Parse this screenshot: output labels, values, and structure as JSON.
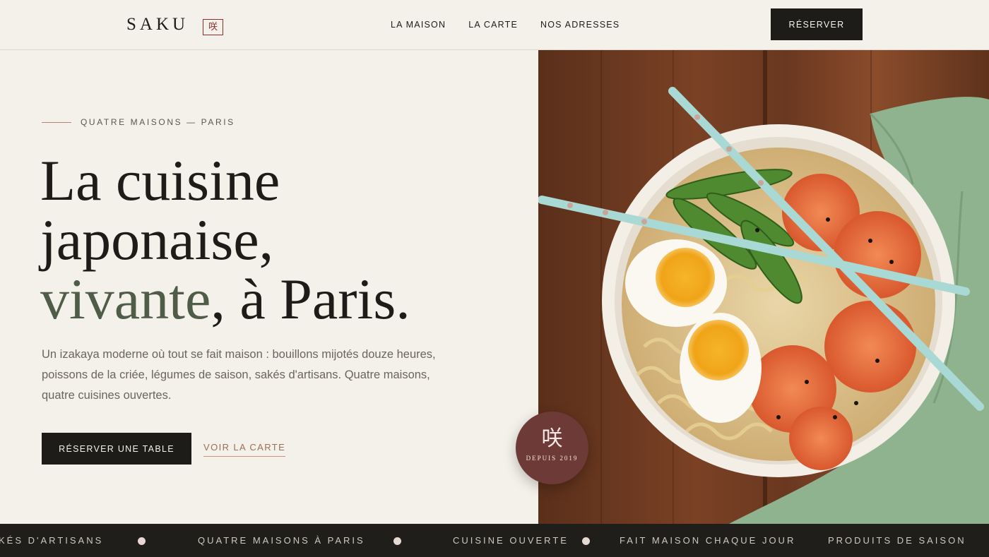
{
  "header": {
    "logo_text": "SAKU",
    "logo_mark": "咲",
    "nav": [
      "LA MAISON",
      "LA CARTE",
      "NOS ADRESSES"
    ],
    "reserve_label": "RÉSERVER"
  },
  "hero": {
    "eyebrow": "QUATRE MAISONS — PARIS",
    "headline": {
      "line1": "La cuisine",
      "line2": "japonaise,",
      "line3_accent": "vivante",
      "line3_rest": ", à Paris."
    },
    "intro": "Un izakaya moderne où tout se fait maison : bouillons mijotés douze heures, poissons de la criée, légumes de saison, sakés d'artisans. Quatre maisons, quatre cuisines ouvertes.",
    "cta_primary": "RÉSERVER UNE TABLE",
    "cta_secondary": "VOIR LA CARTE"
  },
  "seal": {
    "kanji": "咲",
    "since": "DEPUIS 2019"
  },
  "ticker": {
    "items": [
      "KÉS D'ARTISANS",
      "QUATRE MAISONS À PARIS",
      "CUISINE OUVERTE",
      "FAIT MAISON CHAQUE JOUR",
      "PRODUITS DE SAISON"
    ]
  },
  "colors": {
    "background": "#f4f1ea",
    "ink": "#1d1c19",
    "accent_green": "#4f5c48",
    "accent_brick": "#8a2e2e",
    "seal": "#6e3a38"
  }
}
